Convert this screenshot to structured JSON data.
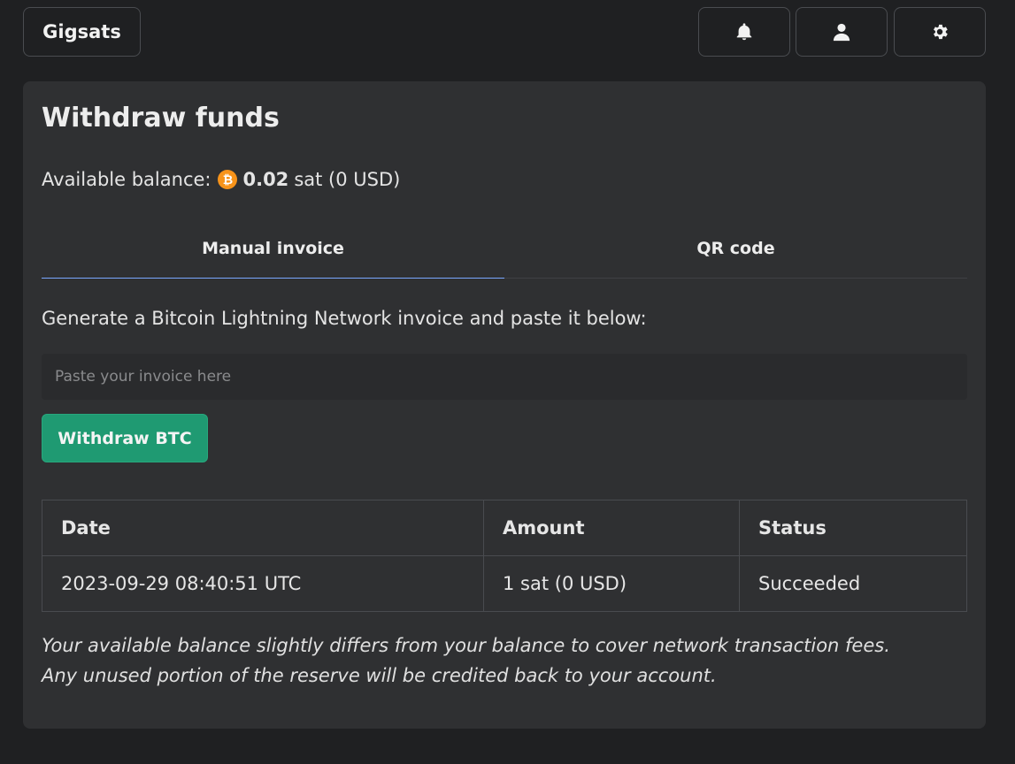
{
  "header": {
    "brand": "Gigsats",
    "icons": [
      "bell-icon",
      "user-icon",
      "gear-icon"
    ]
  },
  "withdraw": {
    "title": "Withdraw funds",
    "balance_label": "Available balance:",
    "coin_symbol": "₿",
    "balance_amount": "0.02",
    "balance_suffix": "sat (0 USD)",
    "tabs": [
      {
        "label": "Manual invoice",
        "active": true
      },
      {
        "label": "QR code",
        "active": false
      }
    ],
    "instruction": "Generate a Bitcoin Lightning Network invoice and paste it below:",
    "input": {
      "placeholder": "Paste your invoice here",
      "value": ""
    },
    "button_label": "Withdraw BTC",
    "table": {
      "headers": [
        "Date",
        "Amount",
        "Status"
      ],
      "rows": [
        [
          "2023-09-29 08:40:51 UTC",
          "1 sat (0 USD)",
          "Succeeded"
        ]
      ]
    },
    "note_lines": [
      "Your available balance slightly differs from your balance to cover network transaction fees.",
      "Any unused portion of the reserve will be credited back to your account."
    ]
  },
  "colors": {
    "background": "#1f2022",
    "card": "#2f3032",
    "accent_green": "#1f9a72",
    "tab_active_line": "#7aa7ff",
    "bitcoin_orange": "#f7931a"
  }
}
